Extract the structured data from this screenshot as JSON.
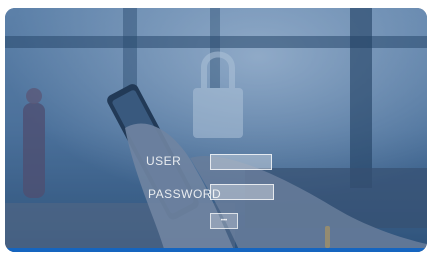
{
  "image": {
    "overlay_color": "#2f5c8f",
    "accent_bar_color": "#1565c0"
  },
  "login_overlay": {
    "username_label": "USER",
    "password_label": "PASSWORD",
    "button_text": "•••"
  }
}
